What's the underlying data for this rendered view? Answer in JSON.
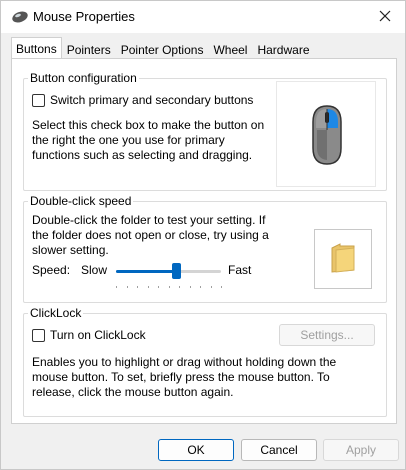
{
  "window": {
    "title": "Mouse Properties",
    "icon": "mouse-icon"
  },
  "tabs": [
    {
      "label": "Buttons",
      "active": true
    },
    {
      "label": "Pointers",
      "active": false
    },
    {
      "label": "Pointer Options",
      "active": false
    },
    {
      "label": "Wheel",
      "active": false
    },
    {
      "label": "Hardware",
      "active": false
    }
  ],
  "button_config": {
    "title": "Button configuration",
    "checkbox_label": "Switch primary and secondary buttons",
    "checked": false,
    "description": "Select this check box to make the button on the right the one you use for primary functions such as selecting and dragging."
  },
  "double_click": {
    "title": "Double-click speed",
    "description": "Double-click the folder to test your setting. If the folder does not open or close, try using a slower setting.",
    "speed_label": "Speed:",
    "slow_label": "Slow",
    "fast_label": "Fast",
    "slider_value": 0.58
  },
  "clicklock": {
    "title": "ClickLock",
    "checkbox_label": "Turn on ClickLock",
    "checked": false,
    "settings_label": "Settings...",
    "settings_enabled": false,
    "description": "Enables you to highlight or drag without holding down the mouse button. To set, briefly press the mouse button. To release, click the mouse button again."
  },
  "footer": {
    "ok_label": "OK",
    "cancel_label": "Cancel",
    "apply_label": "Apply",
    "apply_enabled": false
  },
  "colors": {
    "accent": "#0067c0",
    "mouse_highlight": "#1e88e5",
    "folder": "#f5d57a"
  }
}
